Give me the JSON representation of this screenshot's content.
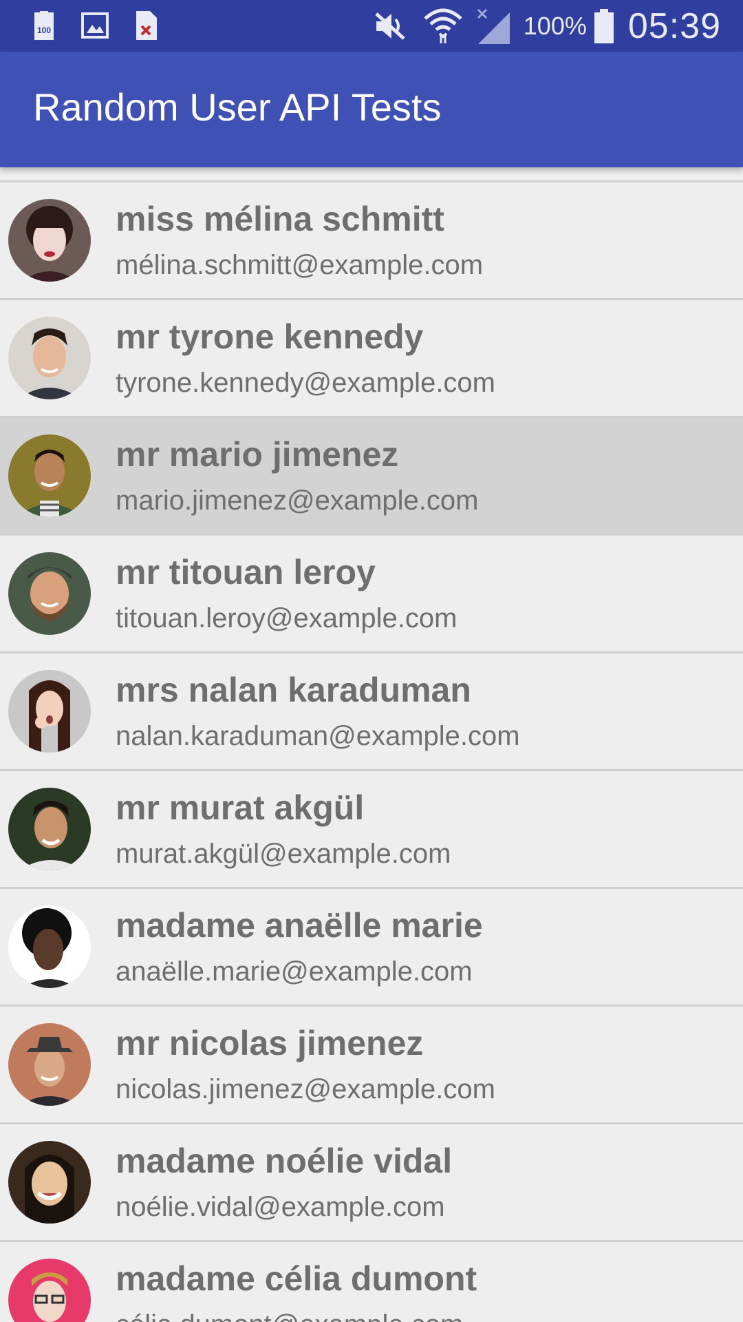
{
  "status_bar": {
    "battery_percent": "100%",
    "time": "05:39",
    "icons": [
      "battery-100-notification-icon",
      "image-notification-icon",
      "file-error-notification-icon",
      "mute-icon",
      "wifi-icon",
      "no-signal-icon",
      "battery-icon"
    ]
  },
  "app_bar": {
    "title": "Random User API Tests"
  },
  "users": [
    {
      "name": "miss mélina schmitt",
      "email": "mélina.schmitt@example.com",
      "pressed": false
    },
    {
      "name": "mr tyrone kennedy",
      "email": "tyrone.kennedy@example.com",
      "pressed": false
    },
    {
      "name": "mr mario jimenez",
      "email": "mario.jimenez@example.com",
      "pressed": true
    },
    {
      "name": "mr titouan leroy",
      "email": "titouan.leroy@example.com",
      "pressed": false
    },
    {
      "name": "mrs nalan karaduman",
      "email": "nalan.karaduman@example.com",
      "pressed": false
    },
    {
      "name": "mr murat akgül",
      "email": "murat.akgül@example.com",
      "pressed": false
    },
    {
      "name": "madame anaëlle marie",
      "email": "anaëlle.marie@example.com",
      "pressed": false
    },
    {
      "name": "mr nicolas jimenez",
      "email": "nicolas.jimenez@example.com",
      "pressed": false
    },
    {
      "name": "madame noélie vidal",
      "email": "noélie.vidal@example.com",
      "pressed": false
    },
    {
      "name": "madame célia dumont",
      "email": "célia.dumont@example.com",
      "pressed": false
    }
  ],
  "colors": {
    "status_bar": "#303f9f",
    "app_bar": "#3f51b5",
    "list_background": "#eeeeee",
    "pressed_row": "#d3d3d3",
    "text": "#6e6e6e"
  }
}
